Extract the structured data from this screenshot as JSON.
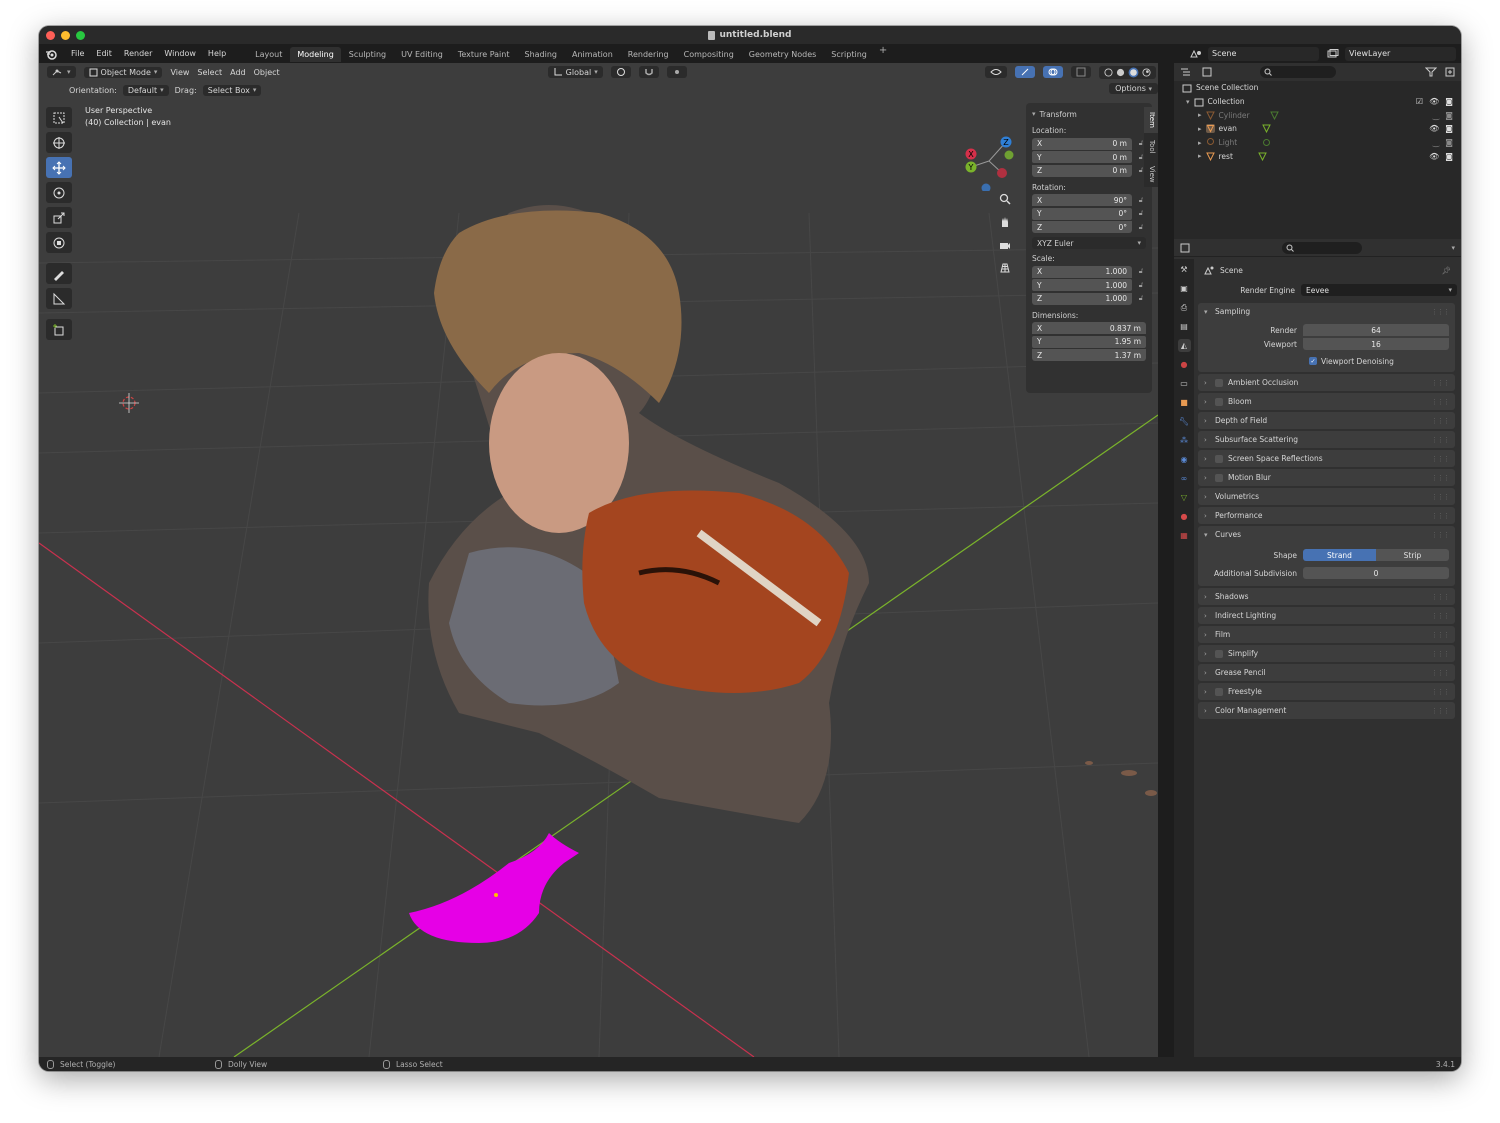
{
  "window": {
    "title": "untitled.blend"
  },
  "menu": {
    "items": [
      "File",
      "Edit",
      "Render",
      "Window",
      "Help"
    ],
    "workspaces": [
      "Layout",
      "Modeling",
      "Sculpting",
      "UV Editing",
      "Texture Paint",
      "Shading",
      "Animation",
      "Rendering",
      "Compositing",
      "Geometry Nodes",
      "Scripting"
    ],
    "active_workspace": "Modeling",
    "add": "+",
    "scene": "Scene",
    "view_layer": "ViewLayer"
  },
  "viewport": {
    "mode": "Object Mode",
    "menus": [
      "View",
      "Select",
      "Add",
      "Object"
    ],
    "transform_orientation": "Global",
    "orientation_label": "Orientation:",
    "orientation_value": "Default",
    "drag_label": "Drag:",
    "drag_value": "Select Box",
    "options": "Options",
    "overlay_line1": "User Perspective",
    "overlay_line2": "(40) Collection | evan",
    "side_tabs": [
      "Item",
      "Tool",
      "View"
    ]
  },
  "transform": {
    "title": "Transform",
    "location_label": "Location:",
    "location": [
      {
        "axis": "X",
        "value": "0 m"
      },
      {
        "axis": "Y",
        "value": "0 m"
      },
      {
        "axis": "Z",
        "value": "0 m"
      }
    ],
    "rotation_label": "Rotation:",
    "rotation": [
      {
        "axis": "X",
        "value": "90°"
      },
      {
        "axis": "Y",
        "value": "0°"
      },
      {
        "axis": "Z",
        "value": "0°"
      }
    ],
    "rotation_mode": "XYZ Euler",
    "scale_label": "Scale:",
    "scale": [
      {
        "axis": "X",
        "value": "1.000"
      },
      {
        "axis": "Y",
        "value": "1.000"
      },
      {
        "axis": "Z",
        "value": "1.000"
      }
    ],
    "dimensions_label": "Dimensions:",
    "dimensions": [
      {
        "axis": "X",
        "value": "0.837 m"
      },
      {
        "axis": "Y",
        "value": "1.95 m"
      },
      {
        "axis": "Z",
        "value": "1.37 m"
      }
    ]
  },
  "outliner": {
    "root": "Scene Collection",
    "collection": "Collection",
    "objects": [
      {
        "name": "Cylinder",
        "dim": true
      },
      {
        "name": "evan",
        "dim": false
      },
      {
        "name": "Light",
        "dim": true
      },
      {
        "name": "rest",
        "dim": false
      }
    ]
  },
  "properties": {
    "scene_label": "Scene",
    "render_engine_label": "Render Engine",
    "render_engine": "Eevee",
    "sampling": {
      "title": "Sampling",
      "render_label": "Render",
      "render": "64",
      "viewport_label": "Viewport",
      "viewport": "16",
      "denoise": "Viewport Denoising"
    },
    "panels_a": [
      {
        "title": "Ambient Occlusion",
        "checkbox": true
      },
      {
        "title": "Bloom",
        "checkbox": true
      },
      {
        "title": "Depth of Field",
        "checkbox": false
      },
      {
        "title": "Subsurface Scattering",
        "checkbox": false
      },
      {
        "title": "Screen Space Reflections",
        "checkbox": true
      },
      {
        "title": "Motion Blur",
        "checkbox": true
      },
      {
        "title": "Volumetrics",
        "checkbox": false
      },
      {
        "title": "Performance",
        "checkbox": false
      }
    ],
    "curves": {
      "title": "Curves",
      "shape_label": "Shape",
      "shape_options": [
        "Strand",
        "Strip"
      ],
      "active_shape": "Strand",
      "subdiv_label": "Additional Subdivision",
      "subdiv": "0"
    },
    "panels_b": [
      {
        "title": "Shadows",
        "checkbox": false
      },
      {
        "title": "Indirect Lighting",
        "checkbox": false
      },
      {
        "title": "Film",
        "checkbox": false
      },
      {
        "title": "Simplify",
        "checkbox": true
      },
      {
        "title": "Grease Pencil",
        "checkbox": false
      },
      {
        "title": "Freestyle",
        "checkbox": true
      },
      {
        "title": "Color Management",
        "checkbox": false
      }
    ]
  },
  "status": {
    "left": "Select (Toggle)",
    "middle": "Dolly View",
    "right": "Lasso Select",
    "version": "3.4.1"
  },
  "colors": {
    "accent": "#4772b3",
    "viewport_bg": "#3d3d3d",
    "x_axis": "#c8314e",
    "y_axis": "#7ab32b",
    "selected_object": "#e600e6"
  }
}
